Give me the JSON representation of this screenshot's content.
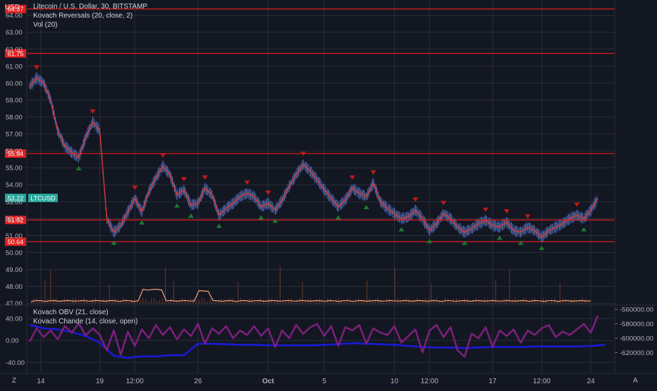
{
  "header": {
    "currency": "USD",
    "legend_main": "Litecoin / U.S. Dollar, 30, BITSTAMP",
    "legend_reversals": "Kovach Reversals (20, close, 2)",
    "legend_vol": "Vol (20)",
    "legend_obv": "Kovach OBV (21, close)",
    "legend_chande": "Kovach Chande (14, close, open)"
  },
  "footer": {
    "tz_icon": "Z",
    "scale_icon": "A"
  },
  "colors": {
    "background": "#131722",
    "grid": "#2a2e39",
    "level_line": "#e01e1e",
    "price_line": "#e53935",
    "band": "#1f3a93",
    "up_arrow": "#1b7a2e",
    "down_arrow": "#c21a1a",
    "volume": "#f2a27a",
    "obv": "#1a1ad6",
    "chande": "#7b1f7b",
    "ticker_badge": "#26a69a"
  },
  "chart_data": [
    {
      "type": "line",
      "title": "Litecoin / U.S. Dollar, 30, BITSTAMP",
      "ylabel": "USD",
      "ylim": [
        46.9,
        64.9
      ],
      "y_ticks": [
        47,
        48,
        49,
        50,
        51,
        52,
        53,
        54,
        55,
        56,
        57,
        58,
        59,
        60,
        61,
        62,
        63,
        64
      ],
      "x_ticks": [
        {
          "label": "14",
          "t": 0.8
        },
        {
          "label": "19",
          "t": 5.0
        },
        {
          "label": "12:00",
          "t": 7.5
        },
        {
          "label": "26",
          "t": 12.0
        },
        {
          "label": "Oct",
          "t": 17.0
        },
        {
          "label": "5",
          "t": 21.0
        },
        {
          "label": "10",
          "t": 26.0
        },
        {
          "label": "12:00",
          "t": 28.5
        },
        {
          "label": "17",
          "t": 33.0
        },
        {
          "label": "12:00",
          "t": 36.5
        },
        {
          "label": "24",
          "t": 40.0
        }
      ],
      "x_range": [
        0,
        41.5
      ],
      "levels": [
        64.37,
        61.75,
        55.84,
        51.92,
        50.64
      ],
      "last_price": 53.22,
      "ticker": "LTCUSD",
      "series": [
        {
          "x": [
            0,
            0.5,
            1,
            1.5,
            2,
            2.5,
            3,
            3.5,
            4,
            4.5,
            5,
            5.5,
            6,
            6.5,
            7,
            7.5,
            8,
            8.5,
            9,
            9.5,
            10,
            10.5,
            11,
            11.5,
            12,
            12.5,
            13,
            13.5,
            14,
            14.5,
            15,
            15.5,
            16,
            16.5,
            17,
            17.5,
            18,
            18.5,
            19,
            19.5,
            20,
            20.5,
            21,
            21.5,
            22,
            22.5,
            23,
            23.5,
            24,
            24.5,
            25,
            25.5,
            26,
            26.5,
            27,
            27.5,
            28,
            28.5,
            29,
            29.5,
            30,
            30.5,
            31,
            31.5,
            32,
            32.5,
            33,
            33.5,
            34,
            34.5,
            35,
            35.5,
            36,
            36.5,
            37,
            37.5,
            38,
            38.5,
            39,
            39.5,
            40,
            40.5
          ],
          "values": [
            59.8,
            60.3,
            60.0,
            59.0,
            57.2,
            56.3,
            55.9,
            55.6,
            56.8,
            57.7,
            57.2,
            52.0,
            51.2,
            51.6,
            52.4,
            53.2,
            52.4,
            53.6,
            54.4,
            55.1,
            54.6,
            53.4,
            53.7,
            52.8,
            52.9,
            53.8,
            53.4,
            52.2,
            52.6,
            52.9,
            53.3,
            53.5,
            53.3,
            52.7,
            52.9,
            52.5,
            53.1,
            53.9,
            54.6,
            55.2,
            54.8,
            54.3,
            53.7,
            53.2,
            52.7,
            53.1,
            53.8,
            53.5,
            53.3,
            54.1,
            53.0,
            52.6,
            52.3,
            52.0,
            52.1,
            52.5,
            52.0,
            51.3,
            51.7,
            52.3,
            52.0,
            51.5,
            51.2,
            51.4,
            51.7,
            51.9,
            51.6,
            51.5,
            51.8,
            51.3,
            51.2,
            51.5,
            51.3,
            50.9,
            51.3,
            51.5,
            51.7,
            52.0,
            52.2,
            52.0,
            52.5,
            53.2
          ]
        }
      ]
    },
    {
      "type": "line",
      "y_ticks": [
        40.0,
        0.0,
        -40.0
      ],
      "ylim": [
        -60,
        63
      ],
      "right_axis_ticks": [
        "-560000.00",
        "-580000.00",
        "-600000.00",
        "-620000.00"
      ],
      "series": [
        {
          "name": "Kovach OBV (21, close)",
          "x": [
            0,
            1,
            2,
            3,
            4,
            5,
            6,
            7,
            8,
            9,
            10,
            11,
            12,
            13,
            14,
            15,
            16,
            17,
            18,
            19,
            20,
            21,
            22,
            23,
            24,
            25,
            26,
            27,
            28,
            29,
            30,
            31,
            32,
            33,
            34,
            35,
            36,
            37,
            38,
            39,
            40,
            41
          ],
          "values": [
            28,
            22,
            20,
            15,
            8,
            -4,
            -28,
            -32,
            -29,
            -29,
            -27,
            -27,
            -6,
            -6,
            -7,
            -8,
            -8,
            -9,
            -9,
            -9,
            -9,
            -8,
            -7,
            -5,
            -6,
            -7,
            -8,
            -10,
            -12,
            -13,
            -13,
            -14,
            -13,
            -12,
            -12,
            -12,
            -11,
            -11,
            -11,
            -11,
            -10,
            -8
          ]
        },
        {
          "name": "Kovach Chande (14, close, open)",
          "x": [
            0,
            0.5,
            1,
            1.5,
            2,
            2.5,
            3,
            3.5,
            4,
            4.5,
            5,
            5.5,
            6,
            6.5,
            7,
            7.5,
            8,
            8.5,
            9,
            9.5,
            10,
            10.5,
            11,
            11.5,
            12,
            12.5,
            13,
            13.5,
            14,
            14.5,
            15,
            15.5,
            16,
            16.5,
            17,
            17.5,
            18,
            18.5,
            19,
            19.5,
            20,
            20.5,
            21,
            21.5,
            22,
            22.5,
            23,
            23.5,
            24,
            24.5,
            25,
            25.5,
            26,
            26.5,
            27,
            27.5,
            28,
            28.5,
            29,
            29.5,
            30,
            30.5,
            31,
            31.5,
            32,
            32.5,
            33,
            33.5,
            34,
            34.5,
            35,
            35.5,
            36,
            36.5,
            37,
            37.5,
            38,
            38.5,
            39,
            39.5,
            40,
            40.5
          ],
          "values": [
            -2,
            22,
            6,
            18,
            2,
            26,
            14,
            31,
            9,
            22,
            10,
            -18,
            18,
            -26,
            16,
            -10,
            20,
            4,
            28,
            10,
            24,
            2,
            20,
            8,
            30,
            -6,
            22,
            12,
            26,
            4,
            18,
            10,
            26,
            8,
            22,
            -12,
            18,
            4,
            28,
            12,
            24,
            30,
            8,
            26,
            -10,
            24,
            18,
            28,
            -6,
            22,
            14,
            10,
            26,
            -4,
            8,
            20,
            -22,
            18,
            28,
            6,
            24,
            -18,
            -30,
            12,
            4,
            24,
            -12,
            18,
            8,
            20,
            -4,
            18,
            10,
            22,
            28,
            6,
            16,
            10,
            20,
            30,
            14,
            45
          ]
        }
      ]
    }
  ]
}
